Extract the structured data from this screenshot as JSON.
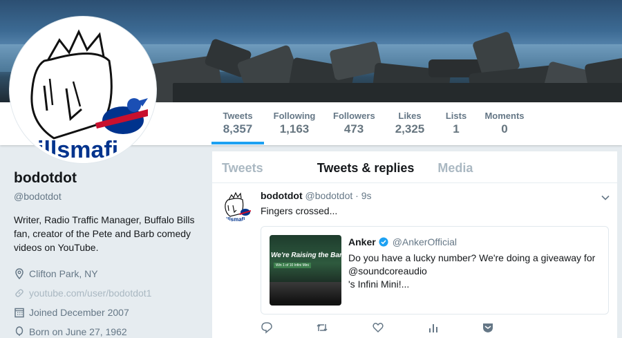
{
  "profile": {
    "display_name": "bodotdot",
    "handle": "@bodotdot",
    "bio": "Writer, Radio Traffic Manager, Buffalo Bills fan, creator of the Pete and Barb comedy videos on YouTube.",
    "location": "Clifton Park, NY",
    "website": "youtube.com/user/bodotdot1",
    "joined": "Joined December 2007",
    "born": "Born on June 27, 1962",
    "avatar_text": "illsmafi"
  },
  "stats": [
    {
      "label": "Tweets",
      "value": "8,357"
    },
    {
      "label": "Following",
      "value": "1,163"
    },
    {
      "label": "Followers",
      "value": "473"
    },
    {
      "label": "Likes",
      "value": "2,325"
    },
    {
      "label": "Lists",
      "value": "1"
    },
    {
      "label": "Moments",
      "value": "0"
    }
  ],
  "tabs": [
    "Tweets",
    "Tweets & replies",
    "Media"
  ],
  "tweet": {
    "name": "bodotdot",
    "handle": "@bodotdot",
    "time": "· 9s",
    "text": "Fingers crossed...",
    "quote": {
      "name": "Anker",
      "handle": "@AnkerOfficial",
      "line1": "Do you have a lucky number? We're doing a giveaway for",
      "line2": "@soundcoreaudio",
      "line3": "'s Infini Mini!...",
      "image_title": "We're Raising the Bar",
      "image_subtitle": "Win 1 of 10 Infini Mini"
    }
  },
  "colors": {
    "accent": "#1da1f2",
    "muted": "#657786",
    "text": "#14171a",
    "bills_red": "#c8102e",
    "bills_blue": "#00338d"
  },
  "icons": [
    "location-icon",
    "link-icon",
    "calendar-icon",
    "balloon-icon",
    "verified-icon",
    "reply-icon",
    "retweet-icon",
    "like-icon",
    "analytics-icon",
    "dm-icon",
    "chevron-down-icon"
  ]
}
